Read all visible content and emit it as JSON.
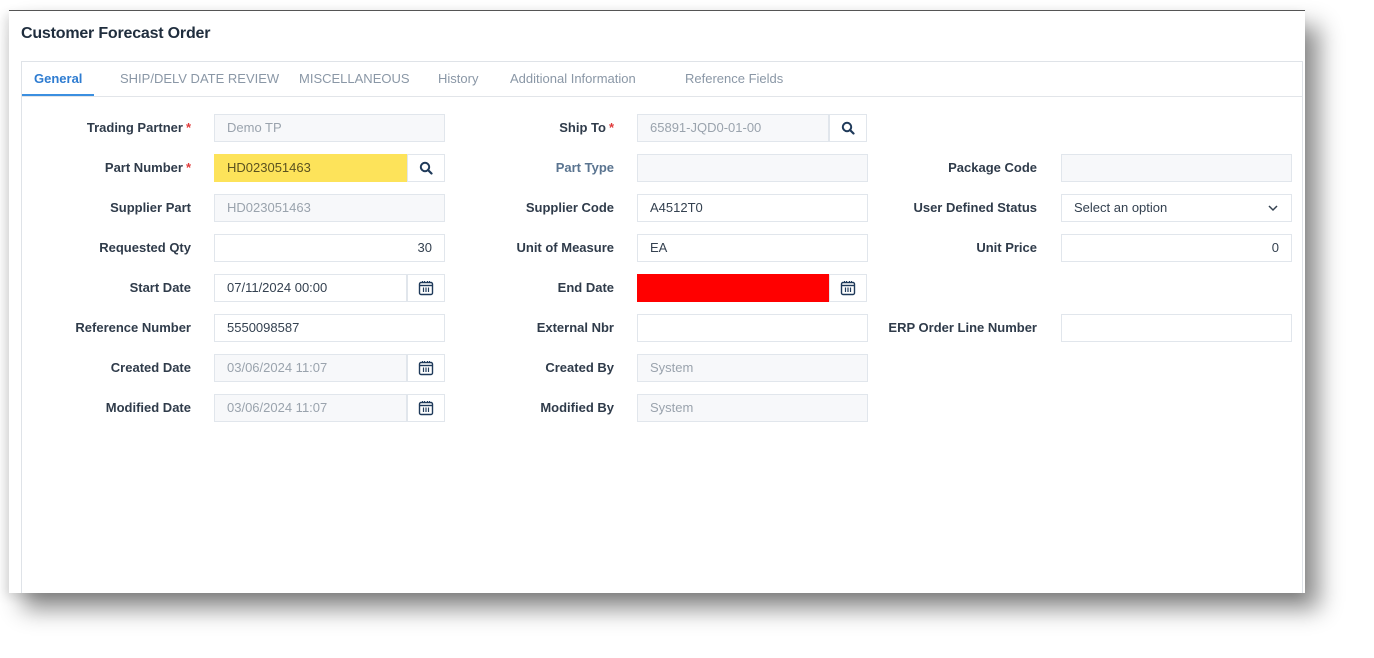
{
  "window": {
    "title": "Customer Forecast Order"
  },
  "tabs": [
    {
      "label": "General",
      "active": true
    },
    {
      "label": "SHIP/DELV DATE REVIEW",
      "active": false
    },
    {
      "label": "MISCELLANEOUS",
      "active": false
    },
    {
      "label": "History",
      "active": false
    },
    {
      "label": "Additional Information",
      "active": false
    },
    {
      "label": "Reference Fields",
      "active": false
    }
  ],
  "form": {
    "trading_partner": {
      "label": "Trading Partner",
      "required": "*",
      "value": "Demo TP"
    },
    "part_number": {
      "label": "Part Number",
      "required": "*",
      "value": "HD023051463",
      "highlight": "#fde35a"
    },
    "supplier_part": {
      "label": "Supplier Part",
      "value": "HD023051463"
    },
    "requested_qty": {
      "label": "Requested Qty",
      "value": "30"
    },
    "start_date": {
      "label": "Start Date",
      "value": "07/11/2024 00:00"
    },
    "reference_number": {
      "label": "Reference Number",
      "value": "5550098587"
    },
    "created_date": {
      "label": "Created Date",
      "value": "03/06/2024 11:07"
    },
    "modified_date": {
      "label": "Modified Date",
      "value": "03/06/2024 11:07"
    },
    "ship_to": {
      "label": "Ship To",
      "required": "*",
      "value": "65891-JQD0-01-00"
    },
    "part_type": {
      "label": "Part Type",
      "value": ""
    },
    "supplier_code": {
      "label": "Supplier Code",
      "value": "A4512T0"
    },
    "unit_of_measure": {
      "label": "Unit of Measure",
      "value": "EA"
    },
    "end_date": {
      "label": "End Date",
      "value": "",
      "highlight": "#ff0000"
    },
    "external_nbr": {
      "label": "External Nbr",
      "value": ""
    },
    "created_by": {
      "label": "Created By",
      "value": "System"
    },
    "modified_by": {
      "label": "Modified By",
      "value": "System"
    },
    "package_code": {
      "label": "Package Code",
      "value": ""
    },
    "user_defined_status": {
      "label": "User Defined Status",
      "value": "Select an option"
    },
    "unit_price": {
      "label": "Unit Price",
      "value": "0"
    },
    "erp_order_line_number": {
      "label": "ERP Order Line Number",
      "value": ""
    }
  },
  "icons": {
    "search": "search-icon",
    "calendar": "calendar-icon",
    "dropdown": "chevron-down-icon"
  },
  "colors": {
    "accent": "#2e7cd1",
    "required": "#e03a3a",
    "icon": "#1f3a5a"
  }
}
